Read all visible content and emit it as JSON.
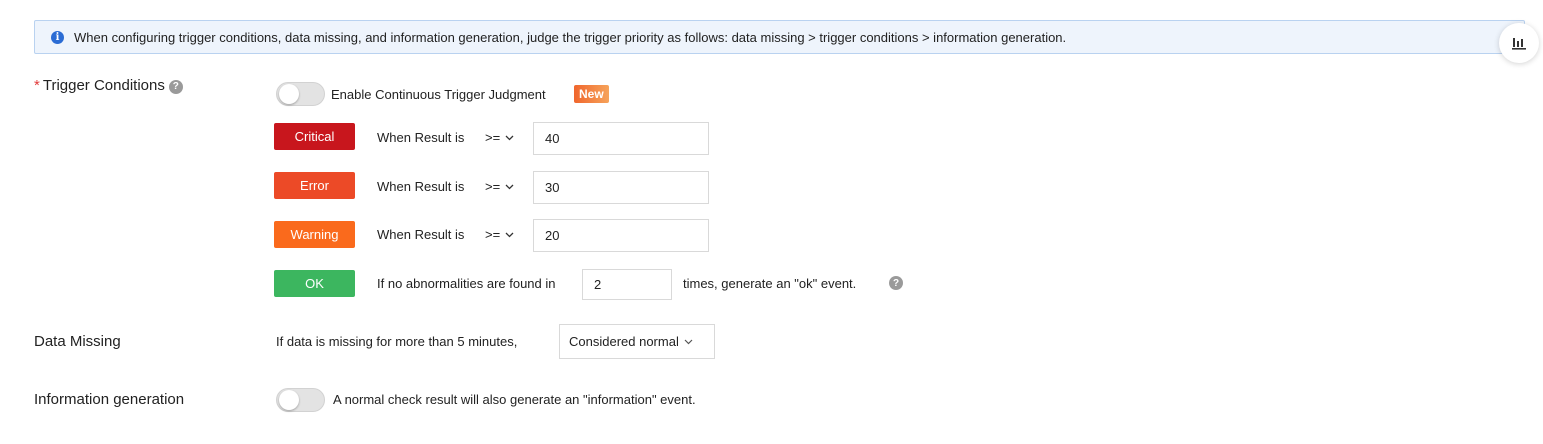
{
  "banner": {
    "info_icon": "info-icon",
    "text": "When configuring trigger conditions, data missing, and information generation, judge the trigger priority as follows: data missing > trigger conditions > information generation."
  },
  "float_button": {
    "icon": "bar-chart-icon"
  },
  "trigger": {
    "required_mark": "*",
    "label": "Trigger Conditions",
    "help_icon": "?",
    "continuous_toggle": {
      "on": false,
      "label": "Enable Continuous Trigger Judgment",
      "badge": "New"
    },
    "levels": [
      {
        "name": "Critical",
        "color": "#c8161d",
        "prefix": "When Result is",
        "operator": ">=",
        "value": "40"
      },
      {
        "name": "Error",
        "color": "#ec4a27",
        "prefix": "When Result is",
        "operator": ">=",
        "value": "30"
      },
      {
        "name": "Warning",
        "color": "#fa6a1c",
        "prefix": "When Result is",
        "operator": ">=",
        "value": "20"
      }
    ],
    "ok": {
      "name": "OK",
      "color": "#3cb65f",
      "prefix": "If no abnormalities are found in",
      "value": "2",
      "suffix": "times, generate an \"ok\" event.",
      "help_icon": "?"
    }
  },
  "data_missing": {
    "label": "Data Missing",
    "text": "If data is missing for more than 5 minutes,",
    "select_value": "Considered normal"
  },
  "info_generation": {
    "label": "Information generation",
    "toggle_on": false,
    "text": "A normal check result will also generate an \"information\" event."
  }
}
